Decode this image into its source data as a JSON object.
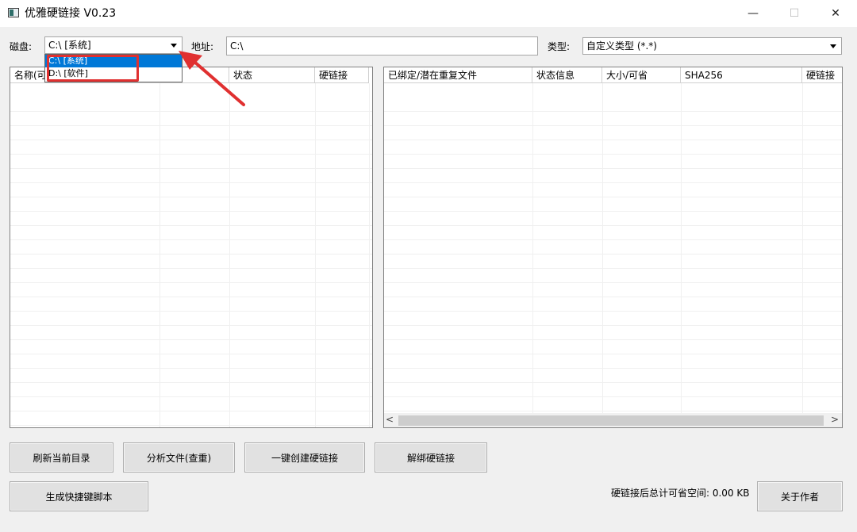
{
  "window": {
    "title": "优雅硬链接 V0.23",
    "minimize": "—",
    "maximize": "☐",
    "close": "✕"
  },
  "toolbar": {
    "disk_label": "磁盘:",
    "disk_value": "C:\\ [系统]",
    "address_label": "地址:",
    "address_value": "C:\\",
    "type_label": "类型:",
    "type_value": "自定义类型 (*.*)"
  },
  "disk_dropdown": {
    "options": [
      "C:\\ [系统]",
      "D:\\ [软件]"
    ],
    "selected_index": 0
  },
  "left_list": {
    "columns": [
      "名称(可",
      "",
      "状态",
      "硬链接"
    ]
  },
  "right_list": {
    "columns": [
      "已绑定/潜在重复文件",
      "状态信息",
      "大小/可省",
      "SHA256",
      "硬链接"
    ]
  },
  "buttons": {
    "refresh": "刷新当前目录",
    "analyze": "分析文件(查重)",
    "create": "一键创建硬链接",
    "unbind": "解绑硬链接",
    "script": "生成快捷键脚本",
    "about": "关于作者"
  },
  "status": {
    "savable_space": "硬链接后总计可省空间: 0.00 KB"
  },
  "scrollbar": {
    "left_arrow": "<",
    "right_arrow": ">"
  },
  "colors": {
    "selection": "#0078d7",
    "annotation": "#e03030"
  }
}
